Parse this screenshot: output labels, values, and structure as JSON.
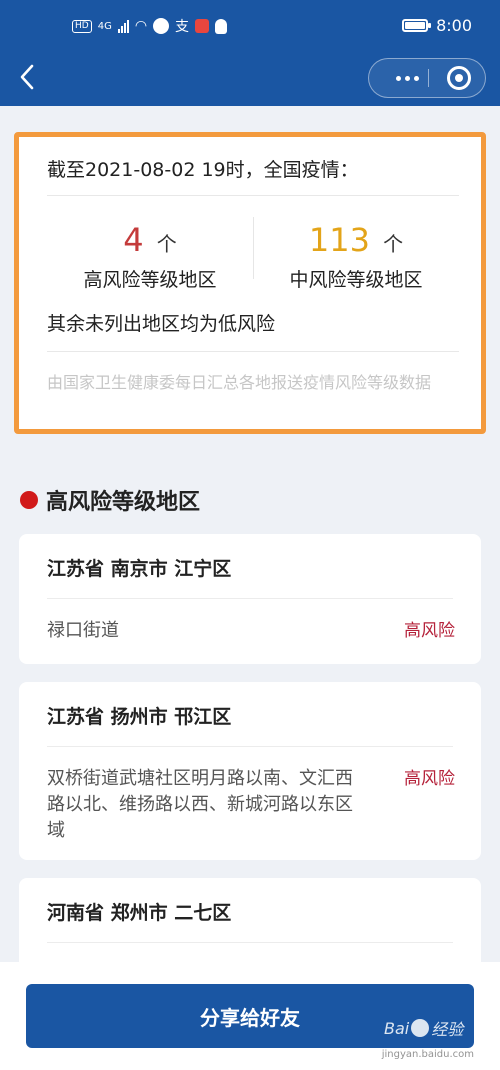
{
  "status_bar": {
    "badge_hd": "HD",
    "network": "4G",
    "icon_text": "支",
    "time": "8:00"
  },
  "summary": {
    "title": "截至2021-08-02 19时，全国疫情：",
    "high": {
      "count": "4",
      "unit": "个",
      "label": "高风险等级地区"
    },
    "mid": {
      "count": "113",
      "unit": "个",
      "label": "中风险等级地区"
    },
    "low_note": "其余未列出地区均为低风险",
    "source_note": "由国家卫生健康委每日汇总各地报送疫情风险等级数据"
  },
  "section": {
    "title": "高风险等级地区"
  },
  "regions": [
    {
      "name": "江苏省 南京市 江宁区",
      "address": "禄口街道",
      "level": "高风险"
    },
    {
      "name": "江苏省 扬州市 邗江区",
      "address": "双桥街道武塘社区明月路以南、文汇西路以北、维扬路以西、新城河路以东区域",
      "level": "高风险"
    },
    {
      "name": "河南省 郑州市 二七区"
    }
  ],
  "share_button": "分享给好友",
  "watermark": {
    "brand": "Bai",
    "brand2": "经验",
    "url": "jingyan.baidu.com"
  },
  "colors": {
    "brand_blue": "#1a56a3",
    "highlight_border": "#f39a3d",
    "high_risk": "#c43b3b",
    "mid_risk": "#e3a419"
  }
}
